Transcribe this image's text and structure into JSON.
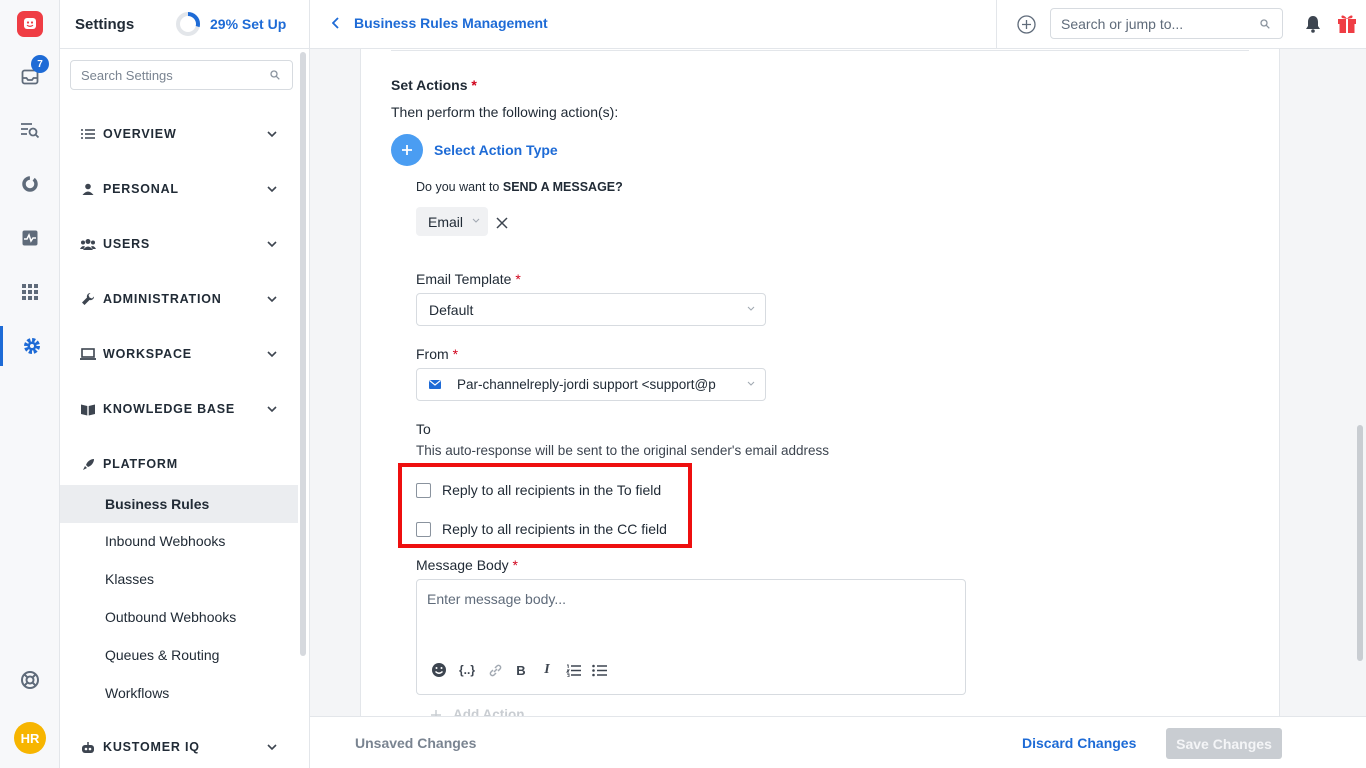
{
  "rail": {
    "inbox_badge": "7",
    "avatar_initials": "HR"
  },
  "sidebar": {
    "title": "Settings",
    "setup_progress": "29% Set Up",
    "setup_fraction": 0.29,
    "search_placeholder": "Search Settings",
    "sections": [
      {
        "label": "OVERVIEW",
        "icon": "list-icon"
      },
      {
        "label": "PERSONAL",
        "icon": "person-icon"
      },
      {
        "label": "USERS",
        "icon": "users-icon"
      },
      {
        "label": "ADMINISTRATION",
        "icon": "wrench-icon"
      },
      {
        "label": "WORKSPACE",
        "icon": "laptop-icon"
      },
      {
        "label": "KNOWLEDGE BASE",
        "icon": "book-icon"
      },
      {
        "label": "PLATFORM",
        "icon": "rocket-icon"
      }
    ],
    "platform_items": [
      "Business Rules",
      "Inbound Webhooks",
      "Klasses",
      "Outbound Webhooks",
      "Queues & Routing",
      "Workflows"
    ],
    "active_item": "Business Rules",
    "bottom_section": {
      "label": "KUSTOMER IQ",
      "icon": "robot-icon"
    }
  },
  "header": {
    "breadcrumb": "Business Rules Management",
    "search_placeholder": "Search or jump to..."
  },
  "form": {
    "set_actions_label": "Set Actions",
    "set_actions_sub": "Then perform the following action(s):",
    "select_action_type": "Select Action Type",
    "send_message_prefix": "Do you want to ",
    "send_message_bold": "SEND A MESSAGE?",
    "channel_chip": "Email",
    "email_template_label": "Email Template",
    "email_template_value": "Default",
    "from_label": "From",
    "from_value": "Par-channelreply-jordi support <support@p",
    "to_label": "To",
    "to_help": "This auto-response will be sent to the original sender's email address",
    "reply_to_label": "Reply to all recipients in the To field",
    "reply_cc_label": "Reply to all recipients in the CC field",
    "message_body_label": "Message Body",
    "message_body_placeholder": "Enter message body...",
    "add_action": "Add Action"
  },
  "footer": {
    "unsaved": "Unsaved Changes",
    "discard": "Discard Changes",
    "save": "Save Changes"
  },
  "colors": {
    "accent": "#1e6bd6",
    "highlight": "#ee0f0f",
    "brand": "#ef3d44"
  }
}
